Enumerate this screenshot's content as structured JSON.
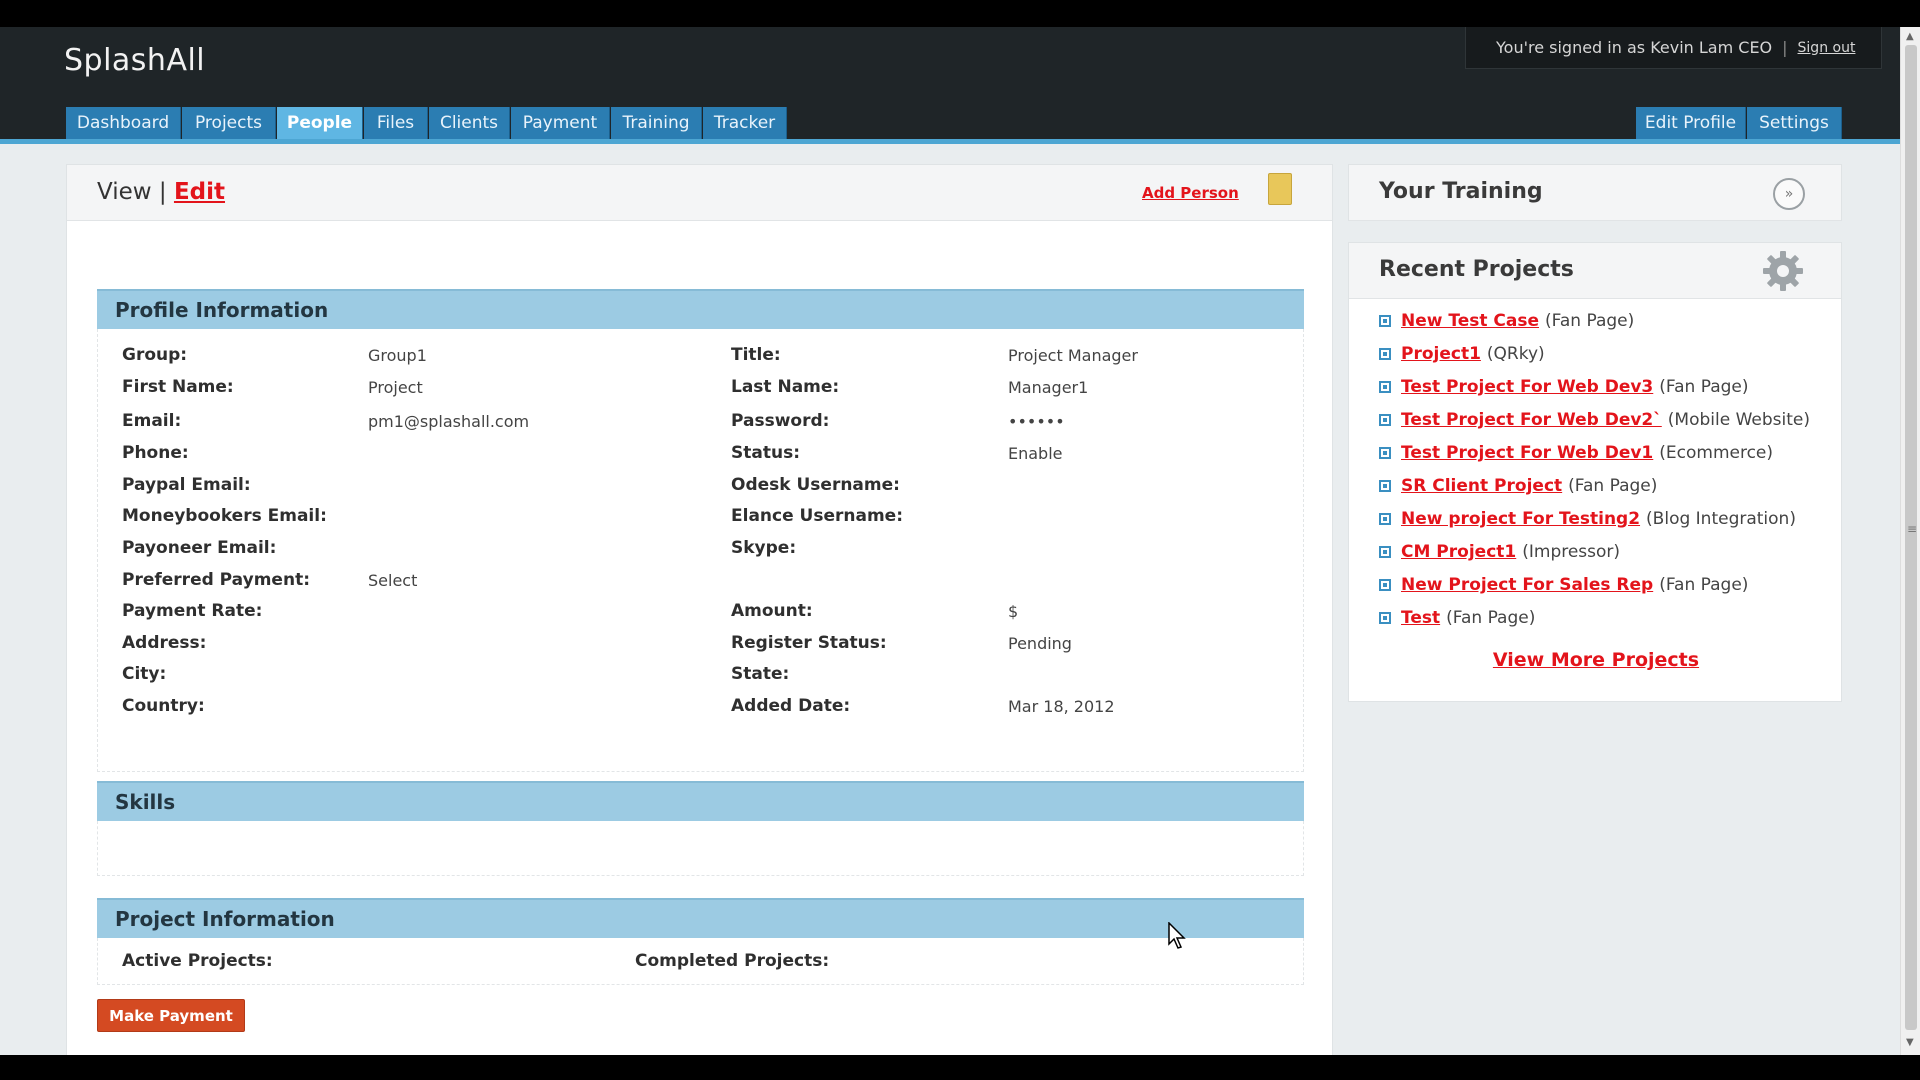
{
  "brand": "SplashAll",
  "account": {
    "signed_in_text": "You're signed in as Kevin Lam CEO",
    "separator": "|",
    "sign_out": "Sign out"
  },
  "nav": {
    "tabs": [
      "Dashboard",
      "Projects",
      "People",
      "Files",
      "Clients",
      "Payment",
      "Training",
      "Tracker"
    ],
    "active": "People",
    "right_tabs": [
      "Edit Profile",
      "Settings"
    ]
  },
  "main": {
    "view_label": "View |",
    "edit_label": "Edit",
    "add_person": "Add Person",
    "sections": {
      "profile": "Profile Information",
      "skills": "Skills",
      "project": "Project Information"
    },
    "profile_left": [
      {
        "label": "Group:",
        "value": "Group1"
      },
      {
        "label": "First Name:",
        "value": "Project"
      },
      {
        "label": "Email:",
        "value": "pm1@splashall.com"
      },
      {
        "label": "Phone:",
        "value": ""
      },
      {
        "label": "Paypal Email:",
        "value": ""
      },
      {
        "label": "Moneybookers Email:",
        "value": ""
      },
      {
        "label": "Payoneer Email:",
        "value": ""
      },
      {
        "label": "Preferred Payment:",
        "value": "Select"
      },
      {
        "label": "Payment Rate:",
        "value": ""
      },
      {
        "label": "Address:",
        "value": ""
      },
      {
        "label": "City:",
        "value": ""
      },
      {
        "label": "Country:",
        "value": ""
      }
    ],
    "profile_right": [
      {
        "label": "Title:",
        "value": "Project Manager"
      },
      {
        "label": "Last Name:",
        "value": "Manager1"
      },
      {
        "label": "Password:",
        "value": "••••••"
      },
      {
        "label": "Status:",
        "value": "Enable"
      },
      {
        "label": "Odesk Username:",
        "value": ""
      },
      {
        "label": "Elance Username:",
        "value": ""
      },
      {
        "label": "Skype:",
        "value": ""
      },
      {
        "label": "",
        "value": ""
      },
      {
        "label": "Amount:",
        "value": "$"
      },
      {
        "label": "Register Status:",
        "value": "Pending"
      },
      {
        "label": "State:",
        "value": ""
      },
      {
        "label": "Added Date:",
        "value": "Mar 18, 2012"
      }
    ],
    "active_projects_label": "Active Projects:",
    "completed_projects_label": "Completed Projects:",
    "make_payment": "Make Payment"
  },
  "sidebar": {
    "training_title": "Your Training",
    "recent_title": "Recent Projects",
    "projects": [
      {
        "name": "New Test Case",
        "type": "(Fan Page)"
      },
      {
        "name": "Project1",
        "type": "(QRky)"
      },
      {
        "name": "Test Project For Web Dev3",
        "type": "(Fan Page)"
      },
      {
        "name": "Test Project For Web Dev2`",
        "type": "(Mobile Website)"
      },
      {
        "name": "Test Project For Web Dev1",
        "type": "(Ecommerce)"
      },
      {
        "name": "SR Client Project",
        "type": "(Fan Page)"
      },
      {
        "name": "New project For Testing2",
        "type": "(Blog Integration)"
      },
      {
        "name": "CM Project1",
        "type": "(Impressor)"
      },
      {
        "name": "New Project For Sales Rep",
        "type": "(Fan Page)"
      },
      {
        "name": "Test",
        "type": "(Fan Page)"
      }
    ],
    "view_more": "View More Projects"
  },
  "icons": {
    "collapse": "double-chevron-down-icon",
    "settings": "gear-icon",
    "document": "document-icon",
    "cursor": "mouse-cursor-icon"
  },
  "colors": {
    "nav_tab": "#2b7db2",
    "nav_active": "#5fb6e3",
    "section_head": "#9ccbe3",
    "link_red": "#e3141b",
    "button_orange": "#d44a22"
  }
}
